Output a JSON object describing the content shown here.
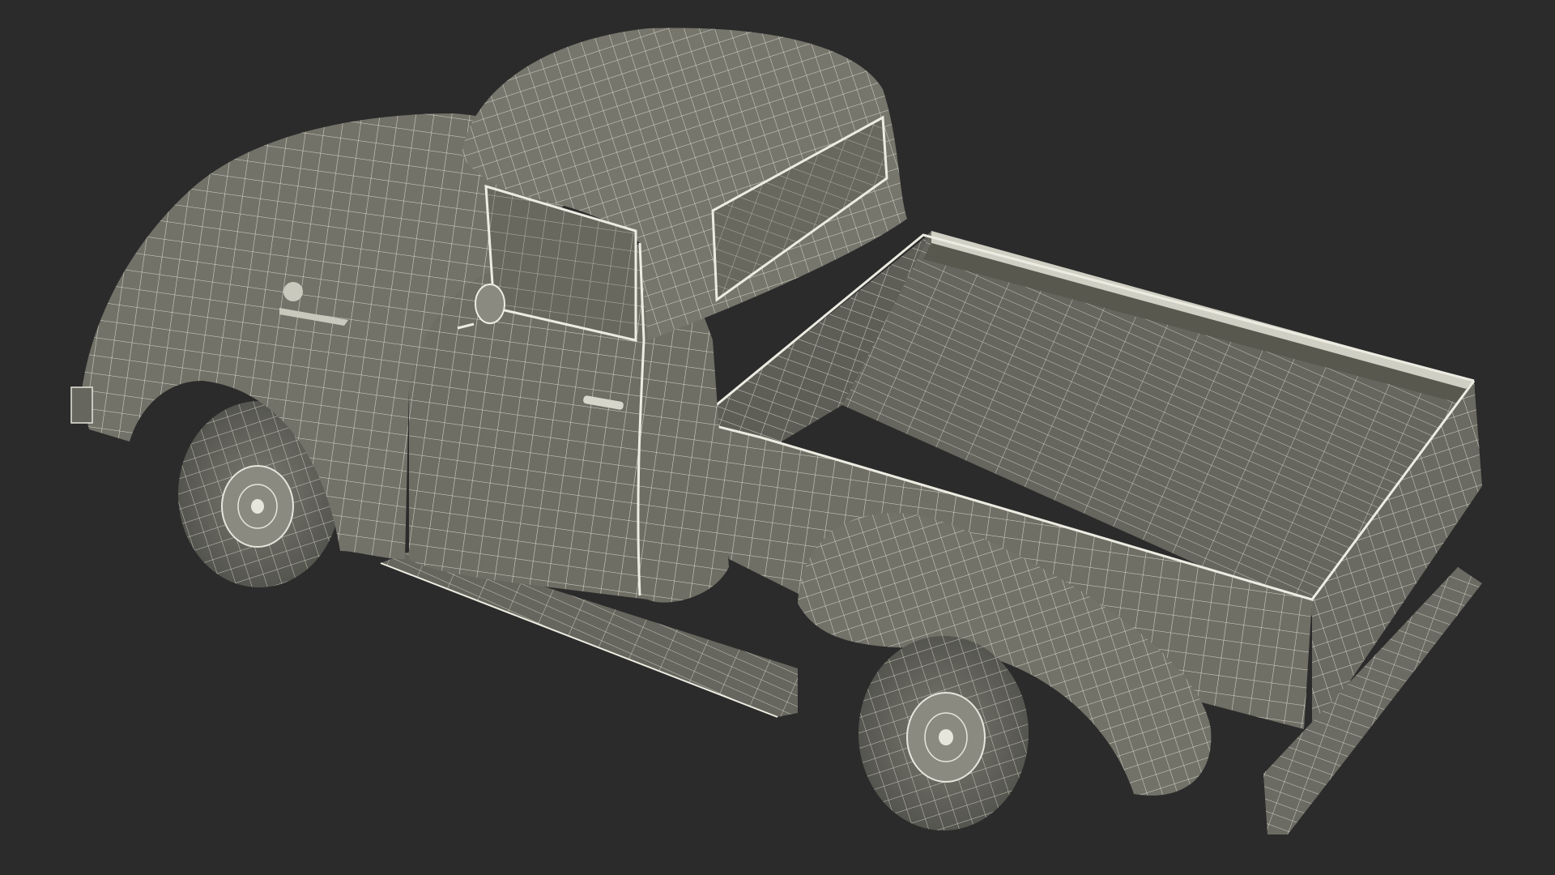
{
  "scene": {
    "background_color": "#2b2b2b",
    "surface_color": "#6f6f66",
    "surface_shade_color": "#5c5c55",
    "surface_light_color": "#86867c",
    "wire_color": "#e6e6dc",
    "subject_icon": "pickup-truck-icon",
    "render_style": "wireframe-over-shaded"
  }
}
